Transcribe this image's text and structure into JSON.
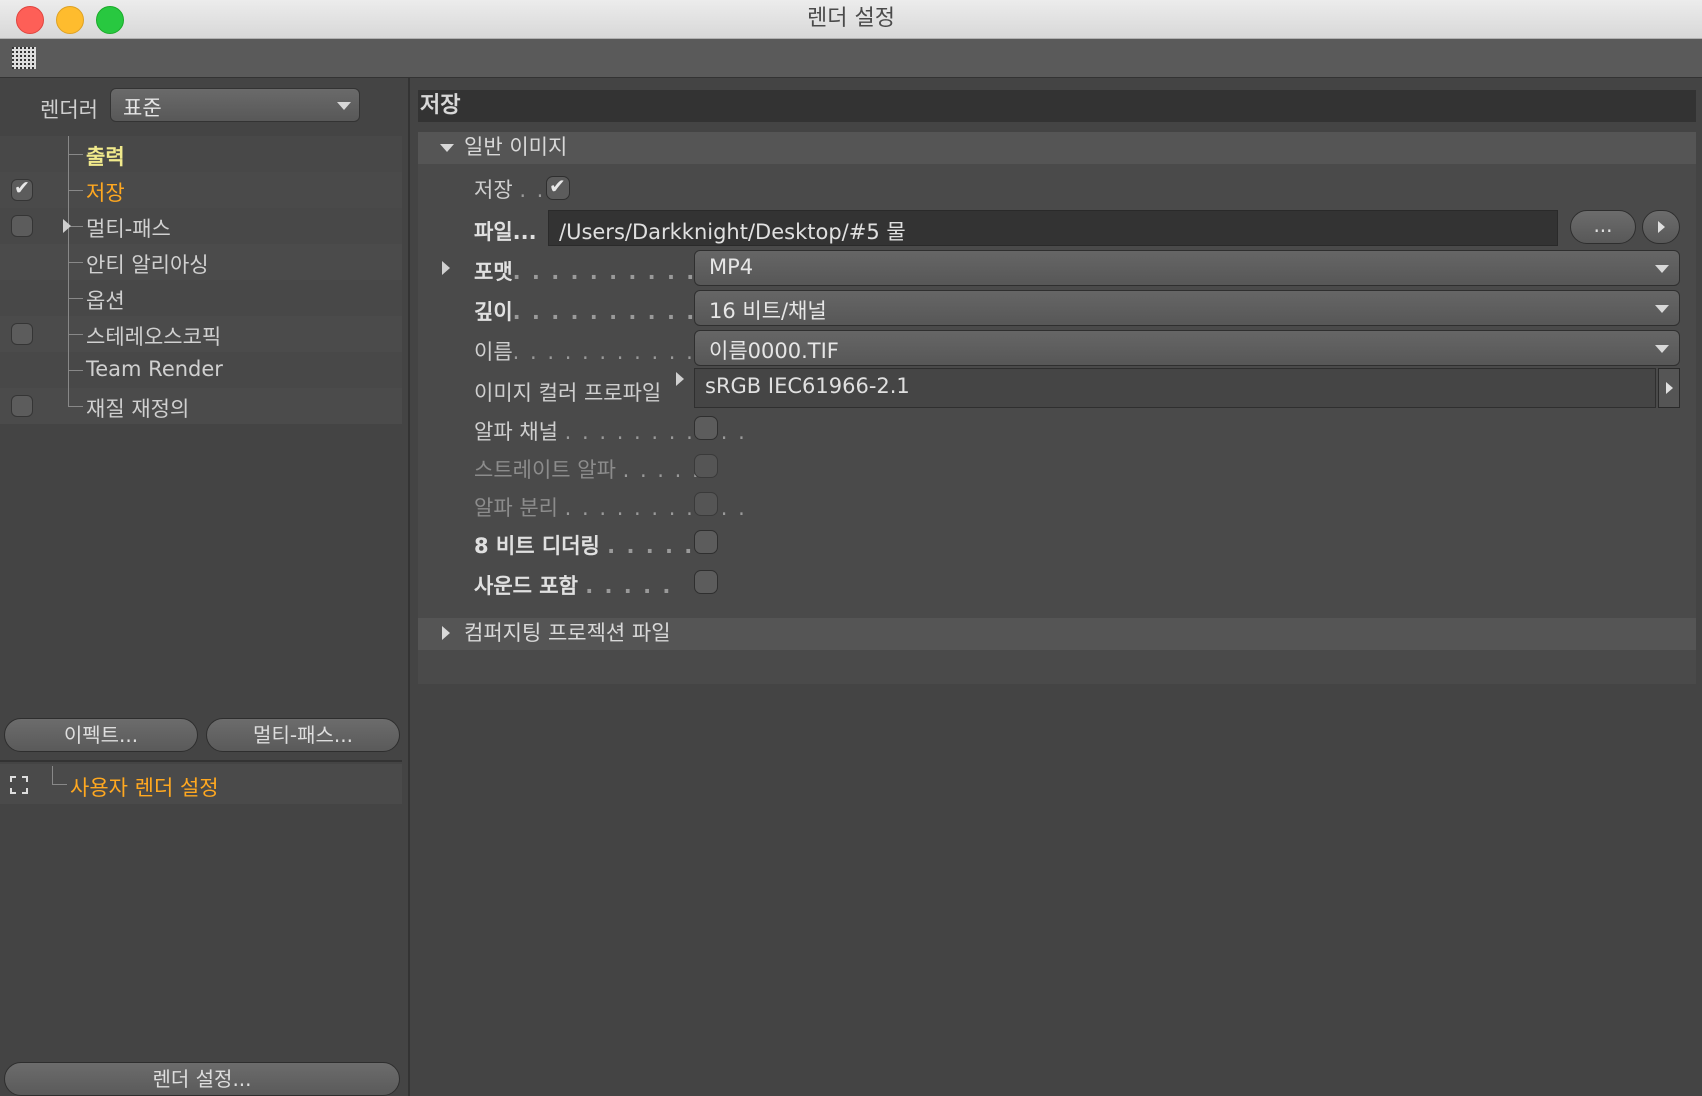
{
  "window": {
    "title": "렌더 설정"
  },
  "left": {
    "renderer_label": "렌더러",
    "renderer_value": "표준",
    "tree": [
      {
        "label": "출력",
        "checked": false,
        "has_checkbox": false
      },
      {
        "label": "저장",
        "checked": true,
        "has_checkbox": true
      },
      {
        "label": "멀티-패스",
        "checked": false,
        "has_checkbox": true,
        "expandable": true
      },
      {
        "label": "안티 알리아싱",
        "checked": false,
        "has_checkbox": false
      },
      {
        "label": "옵션",
        "checked": false,
        "has_checkbox": false
      },
      {
        "label": "스테레오스코픽",
        "checked": false,
        "has_checkbox": true
      },
      {
        "label": "Team Render",
        "checked": false,
        "has_checkbox": false
      },
      {
        "label": "재질 재정의",
        "checked": false,
        "has_checkbox": true
      }
    ],
    "effect_button": "이펙트...",
    "multipass_button": "멀티-패스...",
    "user_settings": "사용자 렌더 설정",
    "render_settings_button": "렌더 설정..."
  },
  "right": {
    "section_title": "저장",
    "group_general": "일반 이미지",
    "save_label": "저장",
    "save_dots": ". .",
    "save_checked": true,
    "file_label": "파일...",
    "file_value": "/Users/Darkknight/Desktop/#5 물",
    "file_browse": "...",
    "format_label": "포맷",
    "format_value": "MP4",
    "depth_label": "깊이",
    "depth_value": "16 비트/채널",
    "name_label": "이름",
    "name_value": "이름0000.TIF",
    "profile_label": "이미지 컬러 프로파일",
    "profile_value": "sRGB IEC61966-2.1",
    "alpha_label": "알파 채널",
    "straight_alpha_label": "스트레이트 알파",
    "separate_alpha_label": "알파 분리",
    "dither_label": "8 비트 디더링",
    "sound_label": "사운드 포함",
    "group_compositing": "컴퍼지팅 프로젝션 파일",
    "dots_long": ". . . . . . . . . . . . .",
    "dots_mid": ". . . . . . . . . . .",
    "dots_short": ". . . . ."
  },
  "colors": {
    "highlight_yellow": "#f1ea8c",
    "highlight_orange": "#ffa820",
    "panel_bg": "#444444"
  }
}
